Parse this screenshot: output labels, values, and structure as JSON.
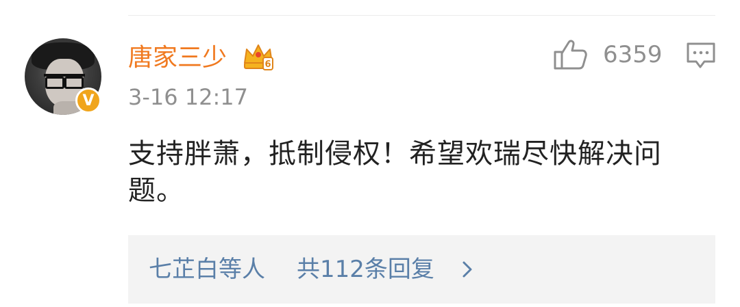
{
  "comment": {
    "username": "唐家三少",
    "timestamp": "3-16 12:17",
    "like_count": "6359",
    "text": "支持胖萧，抵制侵权！希望欢瑞尽快解决问题。",
    "verified_mark": "V",
    "badge_icon": "crown-vip-icon",
    "like_icon": "thumbs-up-icon",
    "comment_icon": "comment-icon"
  },
  "replies": {
    "names": "七芷白等人",
    "count_text": "共112条回复",
    "chevron_icon": "chevron-right-icon"
  },
  "colors": {
    "username": "#f0791f",
    "meta": "#8f8f8f",
    "link": "#5a7fa8",
    "verified": "#f0a51c",
    "reply_bg": "#f3f3f3"
  }
}
